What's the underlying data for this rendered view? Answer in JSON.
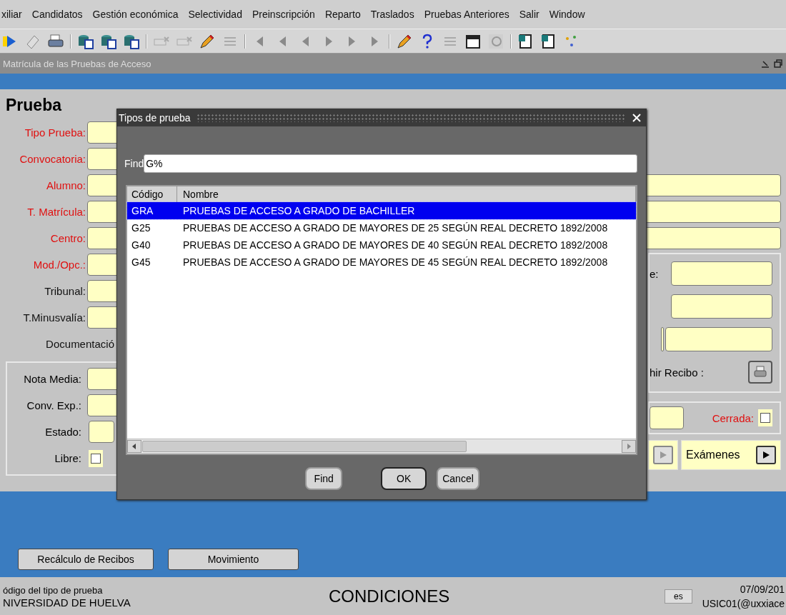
{
  "menu_items": [
    "xiliar",
    "Candidatos",
    "Gestión económica",
    "Selectividad",
    "Preinscripción",
    "Reparto",
    "Traslados",
    "Pruebas Anteriores",
    "Salir",
    "Window"
  ],
  "window": {
    "title": "Matrícula de las Pruebas de Acceso"
  },
  "form": {
    "heading": "Prueba",
    "top_fields": [
      {
        "label": "Tipo Prueba:",
        "required": true,
        "kind": "short"
      },
      {
        "label": "Convocatoria:",
        "required": true,
        "kind": "short"
      },
      {
        "label": "Alumno:",
        "required": true,
        "kind": "wide"
      },
      {
        "label": "T. Matrícula:",
        "required": true,
        "kind": "wide"
      },
      {
        "label": "Centro:",
        "required": true,
        "kind": "wide"
      }
    ],
    "middle_fields": [
      {
        "label": "Mod./Opc.:",
        "required": true,
        "kind": "field"
      },
      {
        "label": "Tribunal:",
        "required": false,
        "kind": "field"
      },
      {
        "label": "T.Minusvalía:",
        "required": false,
        "kind": "field"
      },
      {
        "label": "Documentació",
        "required": false,
        "kind": "label"
      }
    ],
    "grades": [
      {
        "label": "Nota Media:",
        "kind": "field"
      },
      {
        "label": "Conv. Exp.:",
        "kind": "field"
      },
      {
        "label": "Estado:",
        "kind": "small"
      },
      {
        "label": "Libre:",
        "kind": "checkbox",
        "checked": false
      }
    ],
    "right_panel": [
      {
        "label": "e:",
        "kind": "field"
      },
      {
        "kind": "field"
      },
      {
        "kind": "split"
      },
      {
        "label": "hir Recibo :",
        "kind": "print"
      }
    ],
    "closed": {
      "label": "Cerrada:",
      "required": true,
      "checked": false
    },
    "exams": {
      "label": "Exámenes",
      "previous_disabled": true
    }
  },
  "dialog": {
    "title": "Tipos de prueba",
    "find_label": "Find",
    "find_value": "G%",
    "columns": [
      "Código",
      "Nombre"
    ],
    "rows": [
      {
        "code": "GRA",
        "name": "PRUEBAS DE ACCESO A GRADO DE BACHILLER",
        "selected": true
      },
      {
        "code": "G25",
        "name": "PRUEBAS DE ACCESO A GRADO DE MAYORES DE 25 SEGÚN REAL DECRETO 1892/2008",
        "selected": false
      },
      {
        "code": "G40",
        "name": "PRUEBAS DE ACCESO A GRADO DE MAYORES DE 40 SEGÚN REAL DECRETO 1892/2008",
        "selected": false
      },
      {
        "code": "G45",
        "name": "PRUEBAS DE ACCESO A GRADO DE MAYORES DE 45 SEGÚN REAL DECRETO 1892/2008",
        "selected": false
      }
    ],
    "buttons": [
      {
        "label": "Find",
        "default": false
      },
      {
        "label": "OK",
        "default": true
      },
      {
        "label": "Cancel",
        "default": false
      }
    ]
  },
  "bottom_buttons": [
    "Recálculo de Recibos",
    "Movimiento"
  ],
  "status_bar": {
    "hint": "ódigo del tipo de prueba",
    "organization": "NIVERSIDAD DE HUELVA",
    "mode": "CONDICIONES",
    "language": "es",
    "date": "07/09/201",
    "user": "USIC01(@uxxiace"
  }
}
